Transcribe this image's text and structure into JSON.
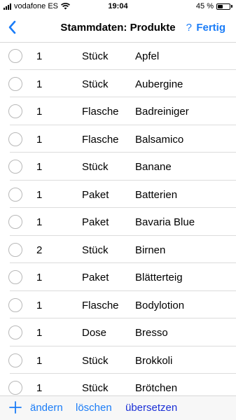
{
  "status": {
    "carrier": "vodafone ES",
    "time": "19:04",
    "battery": "45 %",
    "battery_level": 0.45
  },
  "nav": {
    "back_icon": "chevron-left-icon",
    "title": "Stammdaten: Produkte",
    "help": "?",
    "done": "Fertig"
  },
  "products": [
    {
      "qty": "1",
      "unit": "Stück",
      "name": "Apfel"
    },
    {
      "qty": "1",
      "unit": "Stück",
      "name": "Aubergine"
    },
    {
      "qty": "1",
      "unit": "Flasche",
      "name": "Badreiniger"
    },
    {
      "qty": "1",
      "unit": "Flasche",
      "name": "Balsamico"
    },
    {
      "qty": "1",
      "unit": "Stück",
      "name": "Banane"
    },
    {
      "qty": "1",
      "unit": "Paket",
      "name": "Batterien"
    },
    {
      "qty": "1",
      "unit": "Paket",
      "name": "Bavaria Blue"
    },
    {
      "qty": "2",
      "unit": "Stück",
      "name": "Birnen"
    },
    {
      "qty": "1",
      "unit": "Paket",
      "name": "Blätterteig"
    },
    {
      "qty": "1",
      "unit": "Flasche",
      "name": "Bodylotion"
    },
    {
      "qty": "1",
      "unit": "Dose",
      "name": "Bresso"
    },
    {
      "qty": "1",
      "unit": "Stück",
      "name": "Brokkoli"
    },
    {
      "qty": "1",
      "unit": "Stück",
      "name": "Brötchen"
    }
  ],
  "toolbar": {
    "add_icon": "plus-icon",
    "edit": "ändern",
    "delete": "löschen",
    "translate": "übersetzen"
  },
  "colors": {
    "accent": "#1a7cf7",
    "translate": "#1a2fd6"
  }
}
